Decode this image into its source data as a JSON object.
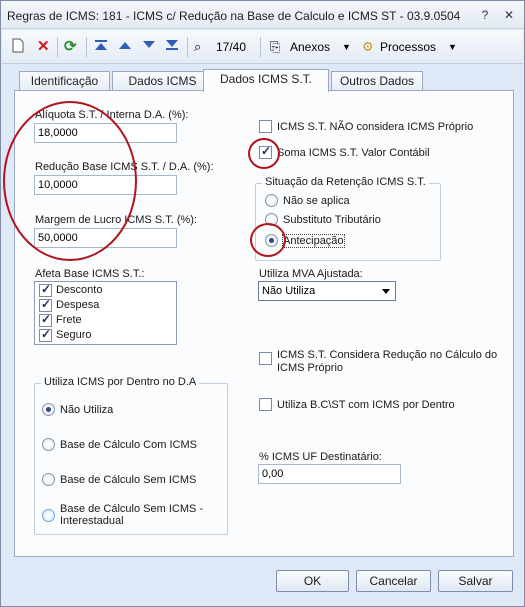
{
  "window": {
    "title": "Regras de ICMS: 181 - ICMS c/ Redução na Base de Calculo e ICMS ST - 03.9.0504"
  },
  "toolbar": {
    "record_position": "17/40",
    "anexos_label": "Anexos",
    "processos_label": "Processos"
  },
  "tabs": [
    "Identificação",
    "Dados ICMS",
    "Dados ICMS S.T.",
    "Outros Dados"
  ],
  "fields": {
    "aliquota_label": "Alíquota S.T. / Interna D.A. (%):",
    "aliquota_value": "18,0000",
    "reducao_label": "Redução Base ICMS S.T. / D.A. (%):",
    "reducao_value": "10,0000",
    "margem_label": "Margem de Lucro ICMS S.T. (%):",
    "margem_value": "50,0000",
    "uf_destinatario_label": "% ICMS UF Destinatário:",
    "uf_destinatario_value": "0,00"
  },
  "checks": {
    "nao_considera": "ICMS S.T. NÃO considera ICMS Próprio",
    "soma_valor_contabil": "Soma ICMS S.T. Valor Contábil",
    "considera_reducao": "ICMS S.T. Considera Redução no Cálculo do ICMS Próprio",
    "bc_st_dentro": "Utiliza B.C\\ST com ICMS por Dentro"
  },
  "retencao": {
    "title": "Situação da Retenção ICMS S.T.",
    "options": [
      "Não se aplica",
      "Substituto Tributário",
      "Antecipação"
    ],
    "selected": "Antecipação"
  },
  "afeta_base": {
    "title": "Afeta Base ICMS S.T.:",
    "items": [
      "Desconto",
      "Despesa",
      "Frete",
      "Seguro"
    ]
  },
  "mva": {
    "label": "Utiliza MVA Ajustada:",
    "value": "Não Utiliza"
  },
  "dentro_da": {
    "title": "Utiliza ICMS por Dentro no D.A",
    "options": [
      "Não Utiliza",
      "Base de Cálculo Com ICMS",
      "Base de Cálculo Sem ICMS",
      "Base de Cálculo Sem ICMS - Interestadual"
    ],
    "selected": "Não Utiliza"
  },
  "buttons": {
    "ok": "OK",
    "cancel": "Cancelar",
    "save": "Salvar"
  },
  "colors": {
    "annotation": "#b0141c",
    "accent": "#2d4b84"
  }
}
